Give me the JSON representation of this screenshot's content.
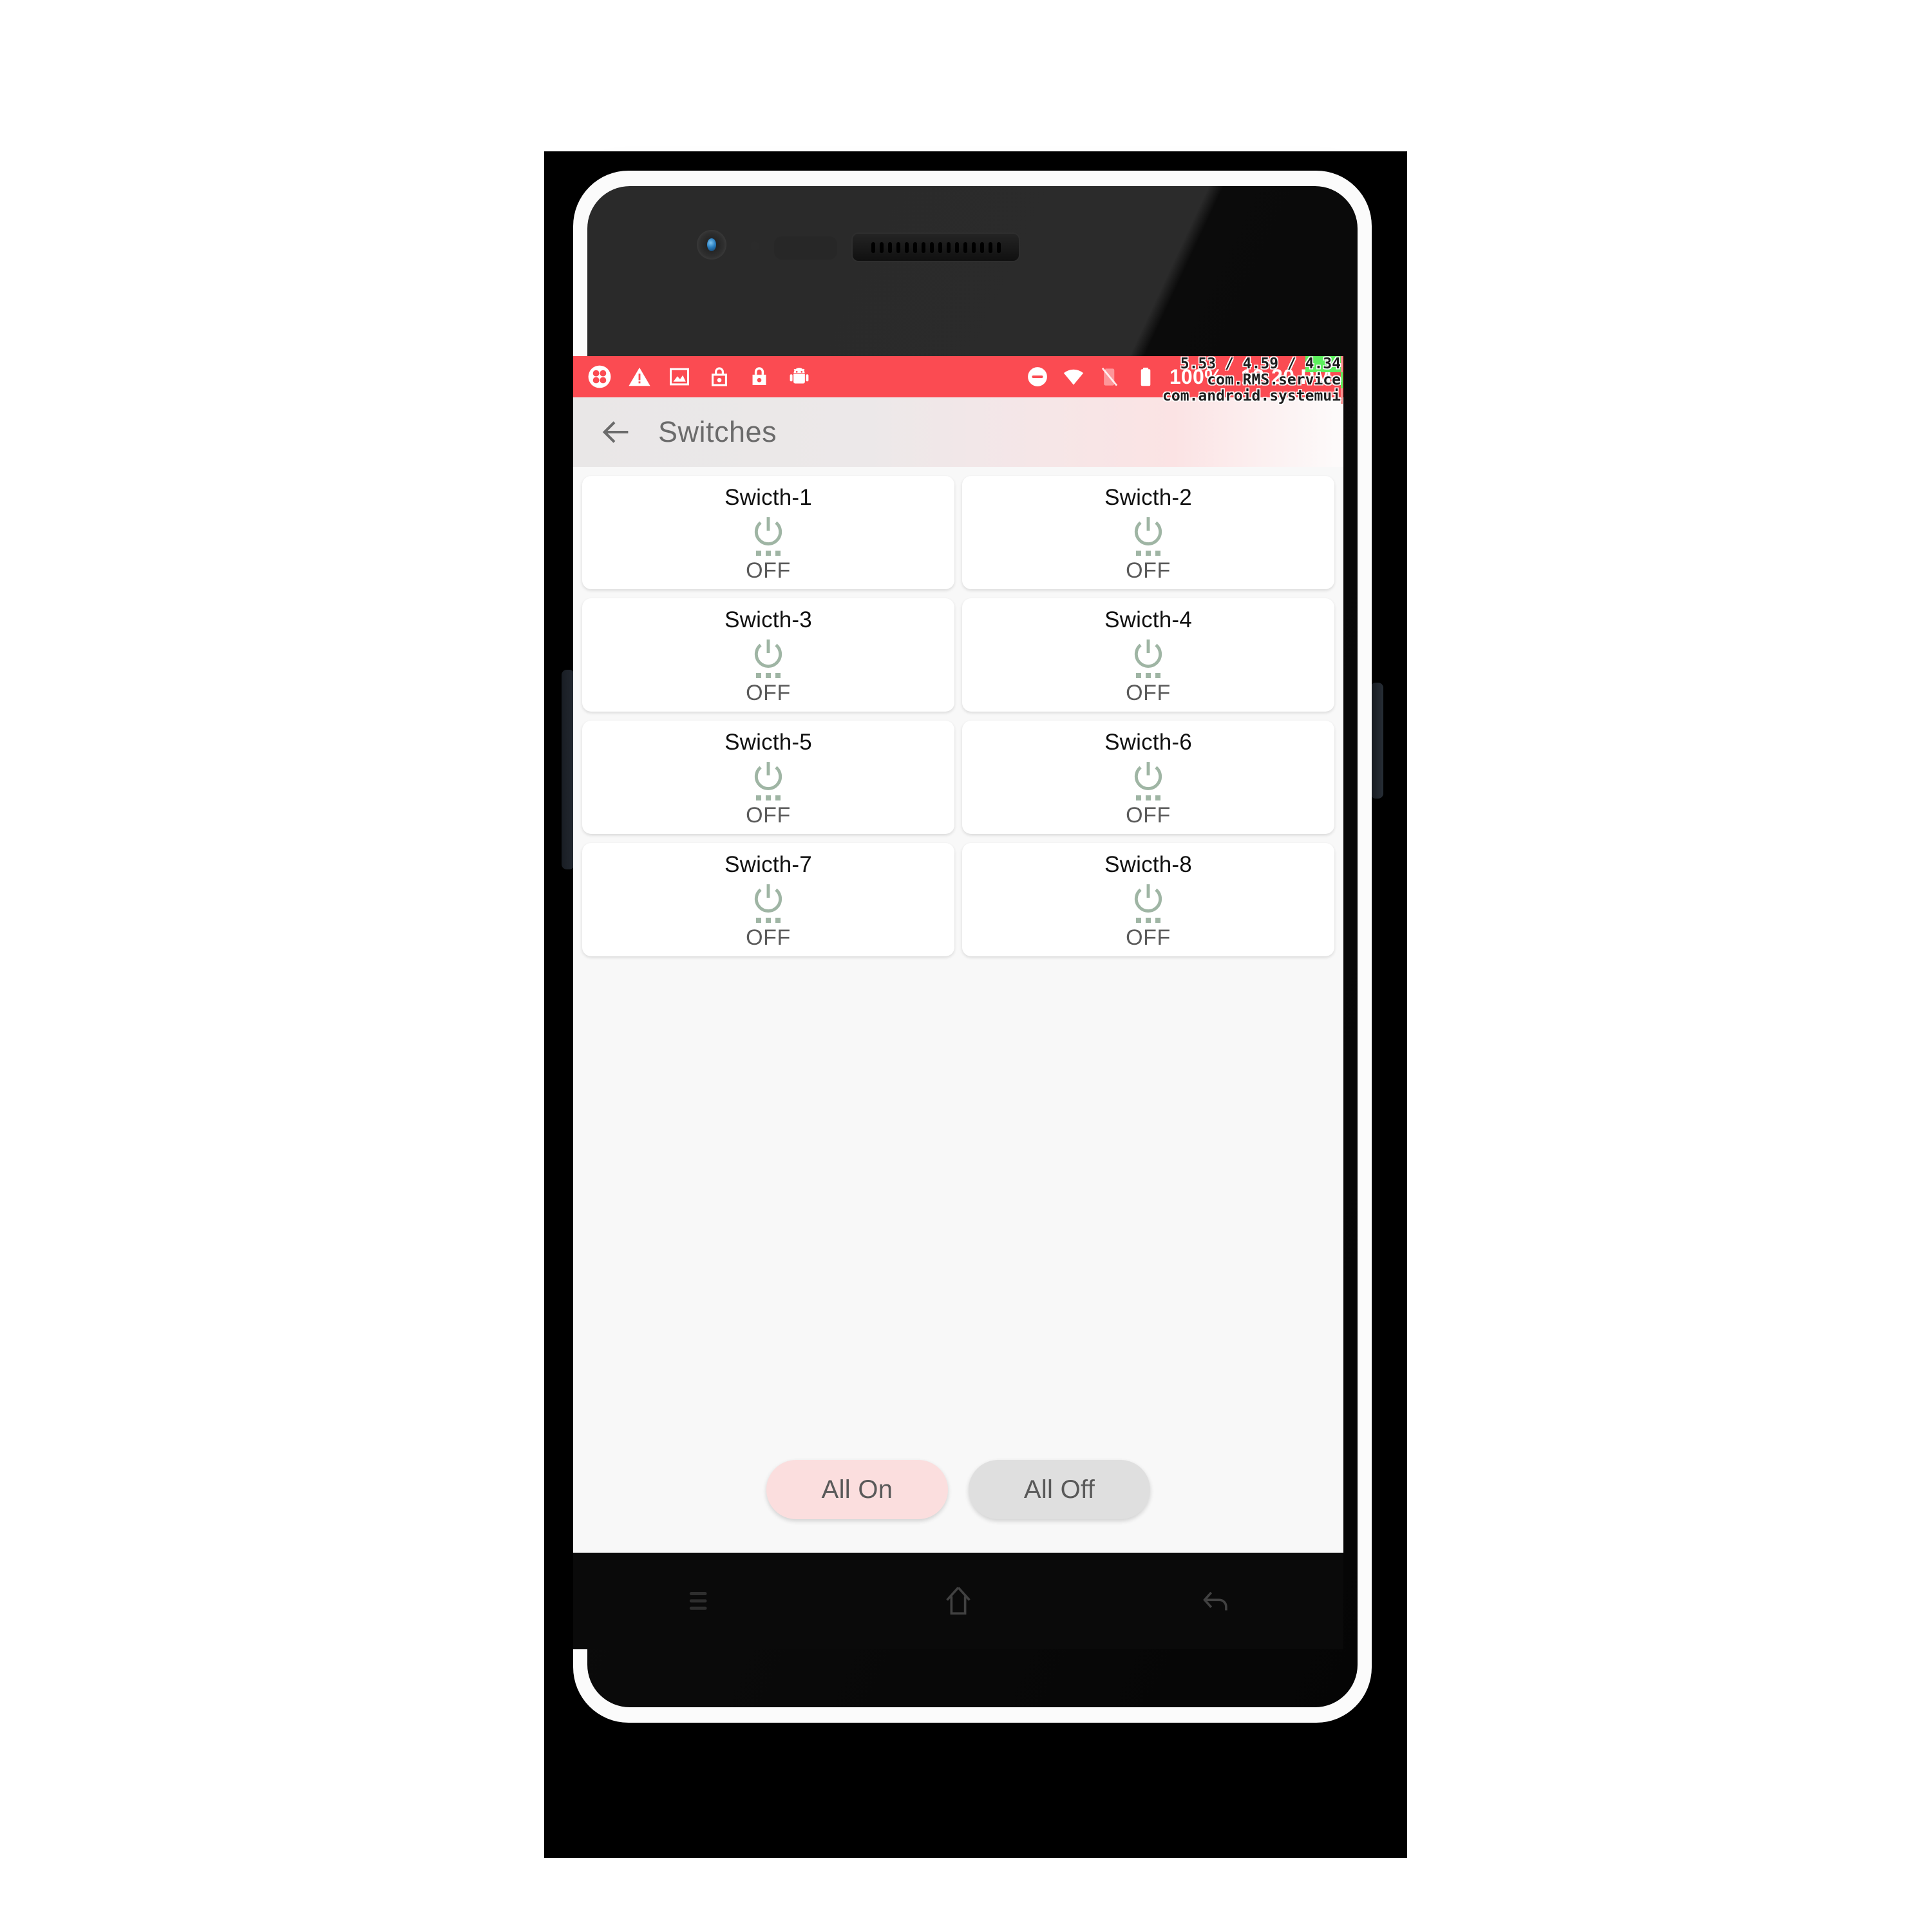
{
  "statusbar": {
    "left_icons": [
      {
        "name": "clover-icon"
      },
      {
        "name": "warning-triangle-icon"
      },
      {
        "name": "image-icon"
      },
      {
        "name": "lock-open-icon"
      },
      {
        "name": "lock-closed-icon"
      },
      {
        "name": "android-robot-icon"
      }
    ],
    "right_icons": [
      {
        "name": "do-not-disturb-icon"
      },
      {
        "name": "wifi-icon"
      },
      {
        "name": "sim-disabled-icon"
      },
      {
        "name": "battery-full-icon"
      }
    ],
    "battery_percent": "100%",
    "clock": "12:20 PM",
    "background_color": "#FB4B52"
  },
  "appbar": {
    "back_icon": "arrow-left-icon",
    "title": "Switches"
  },
  "debug_overlay": {
    "fps_prefix": "5.53 / 4.59 / ",
    "fps_highlight": "4.34",
    "process_1": "com.RMS.service",
    "process_2": "com.android.systemui"
  },
  "switches": [
    {
      "label": "Swicth-1",
      "state": "OFF"
    },
    {
      "label": "Swicth-2",
      "state": "OFF"
    },
    {
      "label": "Swicth-3",
      "state": "OFF"
    },
    {
      "label": "Swicth-4",
      "state": "OFF"
    },
    {
      "label": "Swicth-5",
      "state": "OFF"
    },
    {
      "label": "Swicth-6",
      "state": "OFF"
    },
    {
      "label": "Swicth-7",
      "state": "OFF"
    },
    {
      "label": "Swicth-8",
      "state": "OFF"
    }
  ],
  "actions": {
    "all_on_label": "All On",
    "all_off_label": "All Off",
    "all_on_color": "#FBDEDE",
    "all_off_color": "#DFDFDF"
  },
  "navbar": {
    "menu_icon": "menu-icon",
    "home_icon": "home-icon",
    "back_icon": "back-arrow-icon"
  },
  "theme": {
    "power_icon_color": "#9FB5A4",
    "card_background": "#FFFFFF",
    "screen_background": "#F8F8F8"
  }
}
